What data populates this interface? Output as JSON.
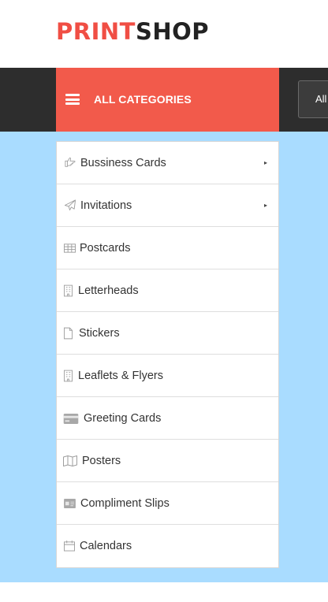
{
  "brand": {
    "part1": "PRINT",
    "part2": "SHOP",
    "accent_color": "#f04e44"
  },
  "nav": {
    "categories_label": "ALL CATEGORIES",
    "categories_bg": "#f25a4b",
    "select_value": "All"
  },
  "menu": {
    "items": [
      {
        "label": "Bussiness Cards",
        "icon": "hand-point-icon",
        "has_submenu": true
      },
      {
        "label": "Invitations",
        "icon": "paper-plane-icon",
        "has_submenu": true
      },
      {
        "label": "Postcards",
        "icon": "table-icon",
        "has_submenu": false
      },
      {
        "label": "Letterheads",
        "icon": "building-icon",
        "has_submenu": false
      },
      {
        "label": "Stickers",
        "icon": "file-icon",
        "has_submenu": false
      },
      {
        "label": "Leaflets & Flyers",
        "icon": "building-icon",
        "has_submenu": false
      },
      {
        "label": "Greeting Cards",
        "icon": "credit-card-icon",
        "has_submenu": false
      },
      {
        "label": "Posters",
        "icon": "map-icon",
        "has_submenu": false
      },
      {
        "label": "Compliment Slips",
        "icon": "id-card-icon",
        "has_submenu": false
      },
      {
        "label": "Calendars",
        "icon": "calendar-icon",
        "has_submenu": false
      }
    ],
    "submenu_arrow": "▸"
  },
  "colors": {
    "content_bg": "#a9dcff",
    "nav_bg": "#2d2d2d"
  }
}
